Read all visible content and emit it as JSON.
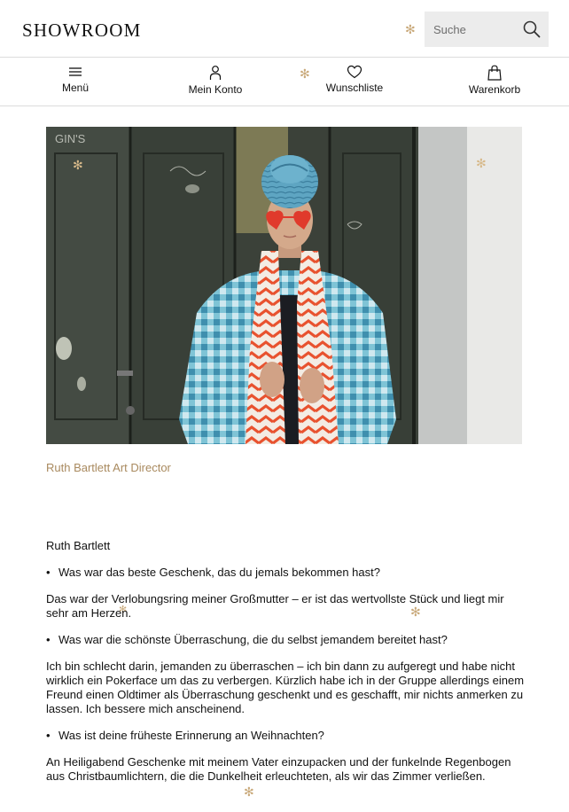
{
  "header": {
    "logo": "SHOWROOM",
    "search_placeholder": "Suche"
  },
  "nav": {
    "items": [
      {
        "label": "Menü",
        "icon": "menu-icon"
      },
      {
        "label": "Mein Konto",
        "icon": "account-icon"
      },
      {
        "label": "Wunschliste",
        "icon": "heart-icon"
      },
      {
        "label": "Warenkorb",
        "icon": "bag-icon"
      }
    ]
  },
  "colors": {
    "accent": "#a98a5f",
    "snowflake": "#c9a97a",
    "divider": "#dcdcdc",
    "search_bg": "#ececec"
  },
  "photo": {
    "subject": "woman-with-turban-and-heart-sunglasses"
  },
  "caption": "Ruth Bartlett Art Director",
  "article": {
    "name": "Ruth Bartlett",
    "qa": [
      {
        "question": "Was war das beste Geschenk, das du jemals bekommen hast?",
        "answer": "Das war der Verlobungsring meiner Großmutter – er ist das wertvollste Stück und liegt mir sehr am Herzen."
      },
      {
        "question": "Was war die schönste Überraschung, die du selbst jemandem bereitet hast?",
        "answer": "Ich bin schlecht darin, jemanden zu überraschen – ich bin dann zu aufgeregt und habe nicht wirklich ein Pokerface um das zu verbergen. Kürzlich habe ich in der Gruppe allerdings einem Freund einen Oldtimer als Überraschung geschenkt und es geschafft, mir nichts anmerken zu lassen. Ich bessere mich anscheinend."
      },
      {
        "question": "Was ist deine früheste Erinnerung an Weihnachten?",
        "answer": "An Heiligabend Geschenke mit meinem Vater einzupacken und der funkelnde Regenbogen aus Christbaumlichtern, die die Dunkelheit erleuchteten, als wir das Zimmer verließen."
      }
    ]
  }
}
